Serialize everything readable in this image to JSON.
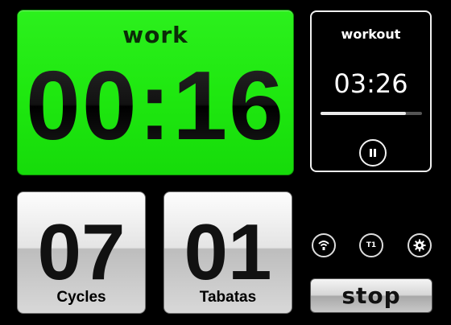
{
  "work": {
    "label": "work",
    "time": "00:16"
  },
  "workout": {
    "title": "workout",
    "time": "03:26",
    "progress": 0.84,
    "pause_icon": "pause-icon"
  },
  "cards": [
    {
      "value": "07",
      "label": "Cycles"
    },
    {
      "value": "01",
      "label": "Tabatas"
    }
  ],
  "controls": {
    "sound_icon": "sound-waves-icon",
    "t1_label": "T1",
    "settings_icon": "gear-icon",
    "stop_label": "stop"
  },
  "colors": {
    "work_green": "#22e813",
    "background": "#000000"
  }
}
